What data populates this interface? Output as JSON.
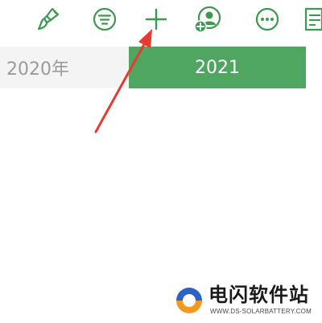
{
  "toolbar": {
    "icons": [
      {
        "name": "brush-icon"
      },
      {
        "name": "filter-list-icon"
      },
      {
        "name": "plus-icon"
      },
      {
        "name": "add-user-icon"
      },
      {
        "name": "more-icon"
      },
      {
        "name": "note-icon"
      }
    ],
    "accent_color": "#3a9a4f"
  },
  "year_tabs": [
    {
      "label": "2020年",
      "selected": false
    },
    {
      "label": "2021",
      "selected": true
    }
  ],
  "selected_color": "#4fa660",
  "annotation": {
    "arrow_color": "#e83a2e"
  },
  "watermark": {
    "title": "电闪软件站",
    "url": "WWW.DS-SOLARBATTERY.COM",
    "logo_colors": [
      "#2b63c8",
      "#f29a1d"
    ]
  }
}
